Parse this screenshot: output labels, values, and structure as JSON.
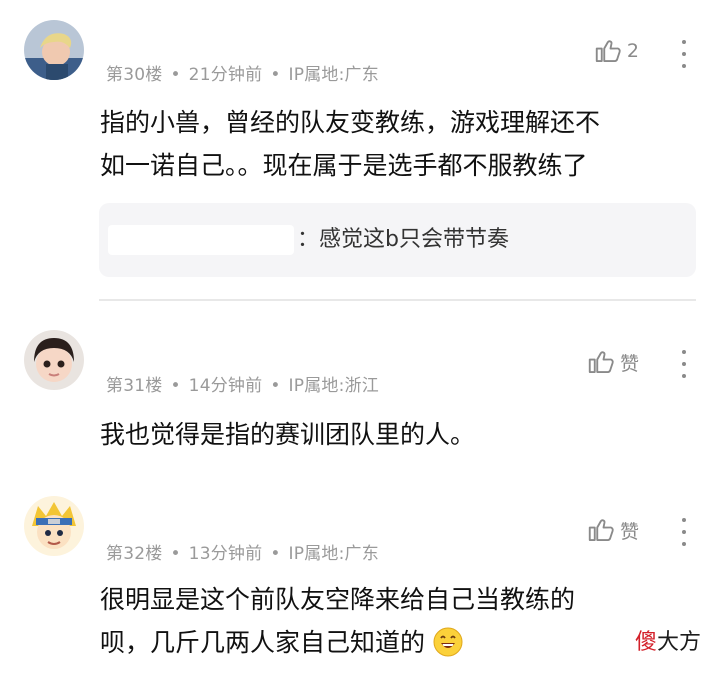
{
  "comments": [
    {
      "floor": "第30楼",
      "time": "21分钟前",
      "ip": "IP属地:广东",
      "like": "2",
      "lines": [
        "指的小兽，曾经的队友变教练，游戏理解还不",
        "如一诺自己。。现在属于是选手都不服教练了"
      ],
      "reply": {
        "text": "：感觉这b只会带节奏"
      },
      "avatar_icon": "user-avatar-blond-hair"
    },
    {
      "floor": "第31楼",
      "time": "14分钟前",
      "ip": "IP属地:浙江",
      "like": "赞",
      "lines": [
        "我也觉得是指的赛训团队里的人。"
      ],
      "avatar_icon": "user-avatar-child"
    },
    {
      "floor": "第32楼",
      "time": "13分钟前",
      "ip": "IP属地:广东",
      "like": "赞",
      "lines": [
        "很明显是这个前队友空降来给自己当教练的",
        "呗，几斤几两人家自己知道的"
      ],
      "emoji": "grinning-emoji",
      "avatar_icon": "user-avatar-cartoon-ninja"
    }
  ],
  "icons": {
    "like": "thumbs-up-icon",
    "more": "more-vertical-icon"
  },
  "watermark": {
    "part1": "傻",
    "part2": "大方"
  },
  "colors": {
    "meta": "#9a9a9a",
    "text": "#111111",
    "reply_bg": "#f5f5f7",
    "watermark_red": "#d3202a"
  }
}
